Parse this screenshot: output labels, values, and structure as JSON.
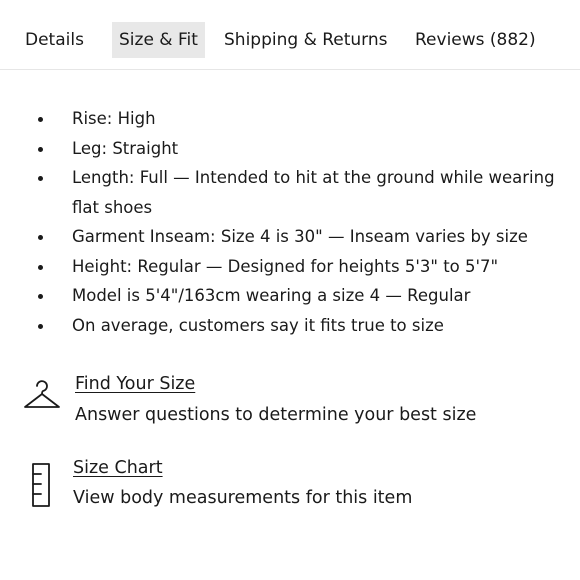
{
  "tabs": [
    {
      "label": "Details",
      "active": false
    },
    {
      "label": "Size & Fit",
      "active": true
    },
    {
      "label": "Shipping & Returns",
      "active": false
    },
    {
      "label": "Reviews (882)",
      "active": false
    }
  ],
  "bullets": [
    "Rise: High",
    "Leg: Straight",
    "Length: Full — Intended to hit at the ground while wearing flat shoes",
    "Garment Inseam: Size 4 is 30\" — Inseam varies by size",
    "Height: Regular — Designed for heights 5'3\" to 5'7\"",
    "Model is 5'4\"/163cm wearing a size 4  —  Regular",
    "On average, customers say it fits true to size"
  ],
  "find_your_size": {
    "icon": "hanger-icon",
    "link": "Find Your Size",
    "description": "Answer questions to determine your best size"
  },
  "size_chart": {
    "icon": "ruler-icon",
    "link": "Size Chart",
    "description": "View body measurements for this item"
  },
  "colors": {
    "text": "#1a1a1a",
    "active_tab_bg": "#e8e8e8",
    "divider": "#e6e6e6"
  }
}
